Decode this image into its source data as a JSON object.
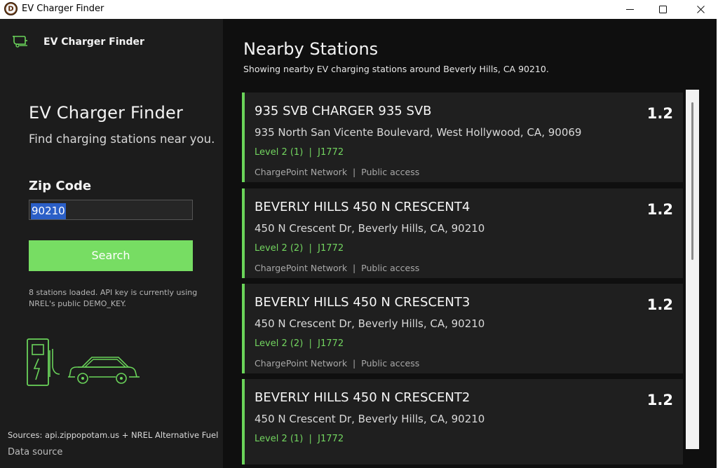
{
  "window": {
    "title": "EV Charger Finder",
    "app_icon_letter": "D"
  },
  "sidebar": {
    "brand": "EV Charger Finder",
    "heading": "EV Charger Finder",
    "tagline": "Find charging stations near you.",
    "zip_label": "Zip Code",
    "zip_value": "90210",
    "search_label": "Search",
    "status": "8 stations loaded. API key is currently using NREL's public DEMO_KEY.",
    "sources": "Sources: api.zippopotam.us + NREL Alternative Fuel",
    "data_source": "Data source"
  },
  "main": {
    "heading": "Nearby Stations",
    "subheading": "Showing nearby EV charging stations around Beverly Hills, CA 90210."
  },
  "stations": [
    {
      "name": "935 SVB CHARGER 935 SVB",
      "address": "935 North San Vicente Boulevard, West Hollywood, CA, 90069",
      "level": "Level 2 (1)  |  J1772",
      "network": "ChargePoint Network  |  Public access",
      "distance": "1.2"
    },
    {
      "name": "BEVERLY HILLS 450 N CRESCENT4",
      "address": "450 N Crescent Dr, Beverly Hills, CA, 90210",
      "level": "Level 2 (2)  |  J1772",
      "network": "ChargePoint Network  |  Public access",
      "distance": "1.2"
    },
    {
      "name": "BEVERLY HILLS 450 N CRESCENT3",
      "address": "450 N Crescent Dr, Beverly Hills, CA, 90210",
      "level": "Level 2 (2)  |  J1772",
      "network": "ChargePoint Network  |  Public access",
      "distance": "1.2"
    },
    {
      "name": "BEVERLY HILLS 450 N CRESCENT2",
      "address": "450 N Crescent Dr, Beverly Hills, CA, 90210",
      "level": "Level 2 (1)  |  J1772",
      "network": "",
      "distance": "1.2"
    }
  ],
  "colors": {
    "accent": "#77dd63",
    "sidebar_bg": "#1c1c1c",
    "main_bg": "#0f0f0f",
    "card_bg": "#1f1f1f",
    "selection": "#2b5fc7"
  },
  "icons": {
    "brand": "ev-plug-icon",
    "illustration": "charger-and-car-illustration",
    "minimize": "minimize-icon",
    "maximize": "maximize-icon",
    "close": "close-icon"
  }
}
